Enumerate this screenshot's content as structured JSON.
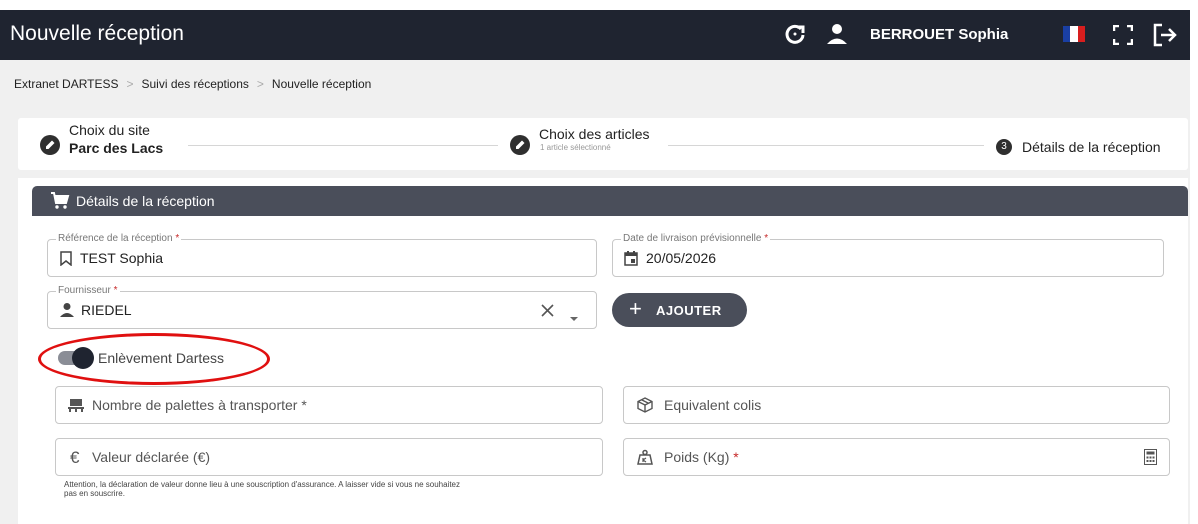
{
  "header": {
    "title": "Nouvelle réception",
    "user_name": "BERROUET Sophia",
    "icons": [
      "refresh-icon",
      "user-icon",
      "french-flag-icon",
      "fullscreen-icon",
      "logout-icon"
    ]
  },
  "breadcrumb": [
    "Extranet DARTESS",
    "Suivi des réceptions",
    "Nouvelle réception"
  ],
  "stepper": {
    "step1": {
      "title": "Choix du site",
      "value": "Parc des Lacs"
    },
    "step2": {
      "title": "Choix des articles",
      "sub": "1 article sélectionné"
    },
    "step3": {
      "number": "3",
      "title": "Détails de la réception"
    }
  },
  "card": {
    "title": "Détails de la réception",
    "reference": {
      "label": "Référence de la réception",
      "value": "TEST Sophia"
    },
    "delivery_date": {
      "label": "Date de livraison prévisionnelle",
      "value": "20/05/2026"
    },
    "supplier": {
      "label": "Fournisseur",
      "value": "RIEDEL"
    },
    "add_button": "AJOUTER",
    "toggle": {
      "label": "Enlèvement Dartess",
      "on": true
    },
    "pallets": {
      "placeholder": "Nombre de palettes à transporter"
    },
    "parcels": {
      "placeholder": "Equivalent colis"
    },
    "declared_value": {
      "placeholder": "Valeur déclarée (€)"
    },
    "weight": {
      "placeholder": "Poids (Kg)"
    },
    "required_mark": "*",
    "help_text": "Attention, la déclaration de valeur donne lieu à une souscription d'assurance. A laisser vide si vous ne souhaitez pas en souscrire."
  },
  "colors": {
    "topbar": "#1f2430",
    "card_header": "#4a4e5a",
    "annotation": "#e01010",
    "flag_blue": "#1a3fa3",
    "flag_red": "#d81e1e"
  }
}
